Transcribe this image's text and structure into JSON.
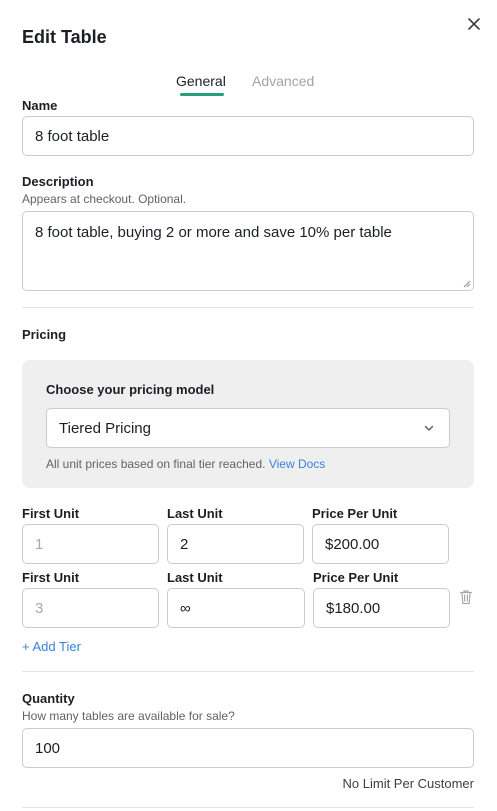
{
  "dialog": {
    "title": "Edit Table"
  },
  "tabs": [
    {
      "label": "General",
      "active": true
    },
    {
      "label": "Advanced",
      "active": false
    }
  ],
  "name": {
    "label": "Name",
    "value": "8 foot table"
  },
  "description": {
    "label": "Description",
    "hint": "Appears at checkout. Optional.",
    "value": "8 foot table, buying 2 or more and save 10% per table"
  },
  "pricing": {
    "heading": "Pricing",
    "model_label": "Choose your pricing model",
    "model_value": "Tiered Pricing",
    "note": "All unit prices based on final tier reached.",
    "docs_link": "View Docs",
    "tiers": [
      {
        "first_label": "First Unit",
        "first_value": "1",
        "last_label": "Last Unit",
        "last_value": "2",
        "price_label": "Price Per Unit",
        "price_value": "$200.00"
      },
      {
        "first_label": "First Unit",
        "first_value": "3",
        "last_label": "Last Unit",
        "last_value": "∞",
        "price_label": "Price Per Unit",
        "price_value": "$180.00"
      }
    ],
    "add_tier": "+ Add Tier"
  },
  "quantity": {
    "label": "Quantity",
    "hint": "How many tables are available for sale?",
    "value": "100",
    "limit_text": "No Limit Per Customer"
  },
  "colors": {
    "accent": "#2a9d7b",
    "link": "#3a83d8",
    "panel": "#efefef"
  }
}
